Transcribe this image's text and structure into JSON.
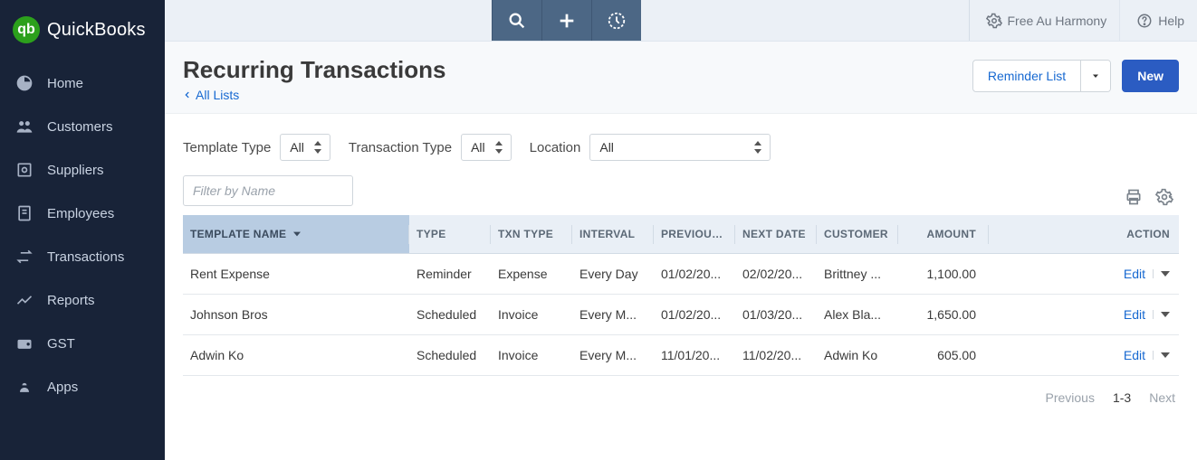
{
  "app": {
    "name": "QuickBooks",
    "logo_letters": "qb"
  },
  "topbar": {
    "harmony_label": "Free Au Harmony",
    "help_label": "Help"
  },
  "sidebar": {
    "items": [
      {
        "label": "Home"
      },
      {
        "label": "Customers"
      },
      {
        "label": "Suppliers"
      },
      {
        "label": "Employees"
      },
      {
        "label": "Transactions"
      },
      {
        "label": "Reports"
      },
      {
        "label": "GST"
      },
      {
        "label": "Apps"
      }
    ]
  },
  "header": {
    "title": "Recurring Transactions",
    "back_label": "All Lists",
    "reminder_button": "Reminder List",
    "new_button": "New"
  },
  "filters": {
    "template_type_label": "Template Type",
    "template_type_value": "All",
    "transaction_type_label": "Transaction Type",
    "transaction_type_value": "All",
    "location_label": "Location",
    "location_value": "All",
    "filter_placeholder": "Filter by Name"
  },
  "table": {
    "columns": {
      "template_name": "TEMPLATE NAME",
      "type": "TYPE",
      "txn_type": "TXN TYPE",
      "interval": "INTERVAL",
      "previous_date": "PREVIOUS D",
      "next_date": "NEXT DATE",
      "customer": "CUSTOMER",
      "amount": "AMOUNT",
      "action": "ACTION"
    },
    "rows": [
      {
        "template_name": "Rent Expense",
        "type": "Reminder",
        "txn_type": "Expense",
        "interval": "Every Day",
        "previous_date": "01/02/20...",
        "next_date": "02/02/20...",
        "customer": "Brittney ...",
        "amount": "1,100.00",
        "action": "Edit"
      },
      {
        "template_name": "Johnson Bros",
        "type": "Scheduled",
        "txn_type": "Invoice",
        "interval": "Every M...",
        "previous_date": "01/02/20...",
        "next_date": "01/03/20...",
        "customer": "Alex Bla...",
        "amount": "1,650.00",
        "action": "Edit"
      },
      {
        "template_name": "Adwin Ko",
        "type": "Scheduled",
        "txn_type": "Invoice",
        "interval": "Every M...",
        "previous_date": "11/01/20...",
        "next_date": "11/02/20...",
        "customer": "Adwin Ko",
        "amount": "605.00",
        "action": "Edit"
      }
    ]
  },
  "pagination": {
    "previous": "Previous",
    "range": "1-3",
    "next": "Next"
  }
}
